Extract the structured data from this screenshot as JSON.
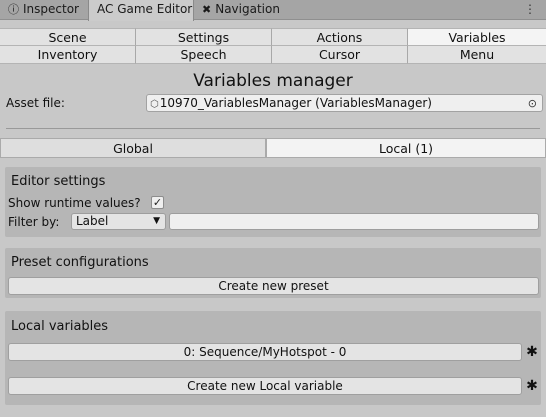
{
  "window_tabs": [
    {
      "label": "Inspector",
      "icon": "info-icon",
      "glyph": "ⓘ"
    },
    {
      "label": "AC Game Editor"
    },
    {
      "label": "Navigation",
      "icon": "navigation-icon",
      "glyph": "✖"
    }
  ],
  "menu_glyph": "⋮",
  "nav": {
    "row1": [
      "Scene",
      "Settings",
      "Actions",
      "Variables"
    ],
    "row2": [
      "Inventory",
      "Speech",
      "Cursor",
      "Menu"
    ],
    "selected": "Variables"
  },
  "title": "Variables manager",
  "asset": {
    "label": "Asset file:",
    "value": "10970_VariablesManager (VariablesManager)",
    "icon_glyph": "⬡",
    "picker_glyph": "⊙"
  },
  "scope_tabs": {
    "global": "Global",
    "local": "Local (1)"
  },
  "editor_settings": {
    "title": "Editor settings",
    "show_runtime_label": "Show runtime values?",
    "show_runtime_checked": true,
    "check_glyph": "✓",
    "filter_label": "Filter by:",
    "filter_value": "Label",
    "dropdown_glyph": "▼",
    "filter_text": ""
  },
  "presets": {
    "title": "Preset configurations",
    "create_label": "Create new preset"
  },
  "local_vars": {
    "title": "Local variables",
    "items": [
      "0: Sequence/MyHotspot - 0"
    ],
    "create_label": "Create new Local variable",
    "cog_glyph": "✱"
  }
}
